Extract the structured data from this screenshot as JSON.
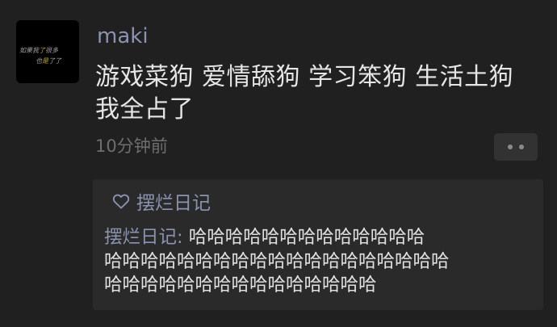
{
  "post": {
    "avatar_text": {
      "line1_part1": "如果我",
      "line1_highlight": "了",
      "line1_part2": "很多",
      "line2_part1": "也",
      "line2_highlight": "是",
      "line2_part2": "了了"
    },
    "username": "maki",
    "text_line1": "游戏菜狗 爱情舔狗 学习笨狗 生活土狗",
    "text_line2": "我全占了",
    "timestamp": "10分钟前"
  },
  "interactions": {
    "likes": [
      "摆烂日记"
    ],
    "comment": {
      "author": "摆烂日记",
      "separator": ": ",
      "line1_text": "哈哈哈哈哈哈哈哈哈哈哈哈哈",
      "line2_text": "哈哈哈哈哈哈哈哈哈哈哈哈哈哈哈哈哈哈哈",
      "line3_text": "哈哈哈哈哈哈哈哈哈哈哈哈哈哈哈"
    }
  },
  "colors": {
    "background": "#202020",
    "panel": "#2a2a2a",
    "name_link": "#8b93b0",
    "text": "#e6e6e6",
    "muted": "#6e6e6e"
  },
  "icons": {
    "more": "more-dots-icon",
    "like": "heart-outline-icon"
  }
}
